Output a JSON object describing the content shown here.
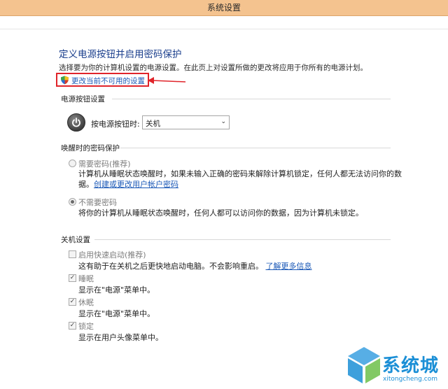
{
  "window": {
    "title": "系统设置"
  },
  "page": {
    "title": "定义电源按钮并启用密码保护",
    "description": "选择要为你的计算机设置的电源设置。在此页上对设置所做的更改将应用于你所有的电源计划。",
    "change_unavailable_link": "更改当前不可用的设置"
  },
  "power_button_section": {
    "header": "电源按钮设置",
    "label": "按电源按钮时:",
    "selected_value": "关机"
  },
  "wake_password_section": {
    "header": "唤醒时的密码保护",
    "require_option": {
      "label": "需要密码(推荐)",
      "desc_line1": "计算机从睡眠状态唤醒时，如果未输入正确的密码来解除计算机锁定，任何人都无法访问你的数",
      "desc_line2_prefix": "据。",
      "desc_link": "创建或更改用户帐户密码",
      "selected": false
    },
    "no_require_option": {
      "label": "不需要密码",
      "desc": "将你的计算机从睡眠状态唤醒时，任何人都可以访问你的数据，因为计算机未锁定。",
      "selected": true
    }
  },
  "shutdown_section": {
    "header": "关机设置",
    "items": [
      {
        "label": "启用快速启动(推荐)",
        "desc": "这有助于在关机之后更快地启动电脑。不会影响重启。",
        "link": "了解更多信息",
        "checked": false
      },
      {
        "label": "睡眠",
        "desc": "显示在\"电源\"菜单中。",
        "checked": true
      },
      {
        "label": "休眠",
        "desc": "显示在\"电源\"菜单中。",
        "checked": true
      },
      {
        "label": "锁定",
        "desc": "显示在用户头像菜单中。",
        "checked": true
      }
    ]
  },
  "watermark": {
    "brand": "系统城",
    "url": "xitongcheng.com"
  },
  "colors": {
    "titlebar": "#f4c38f",
    "link": "#1a58b7",
    "highlight": "#e0242a",
    "heading": "#1a3e8c"
  }
}
